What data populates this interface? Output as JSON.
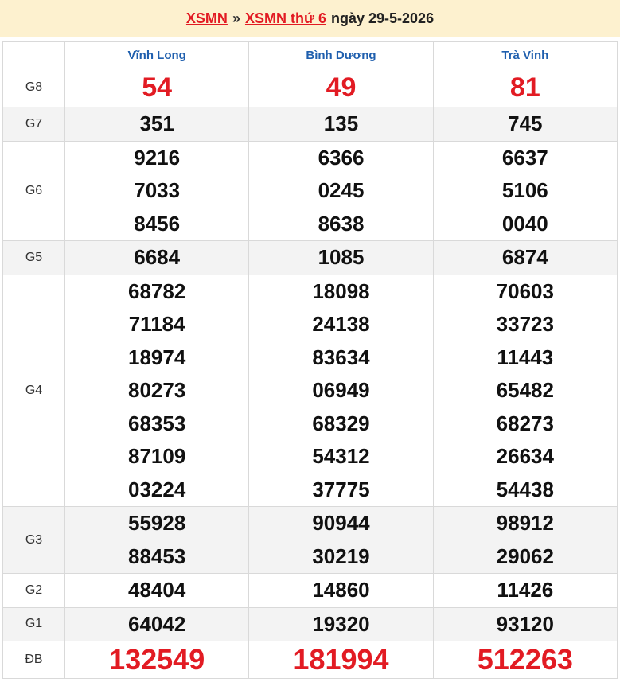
{
  "header": {
    "link1": "XSMN",
    "separator": "»",
    "link2": "XSMN thứ 6",
    "date_text": "ngày 29-5-2026"
  },
  "provinces": [
    "Vĩnh Long",
    "Bình Dương",
    "Trà Vinh"
  ],
  "prizes": [
    {
      "label": "G8",
      "values": [
        [
          "54"
        ],
        [
          "49"
        ],
        [
          "81"
        ]
      ]
    },
    {
      "label": "G7",
      "values": [
        [
          "351"
        ],
        [
          "135"
        ],
        [
          "745"
        ]
      ]
    },
    {
      "label": "G6",
      "values": [
        [
          "9216",
          "7033",
          "8456"
        ],
        [
          "6366",
          "0245",
          "8638"
        ],
        [
          "6637",
          "5106",
          "0040"
        ]
      ]
    },
    {
      "label": "G5",
      "values": [
        [
          "6684"
        ],
        [
          "1085"
        ],
        [
          "6874"
        ]
      ]
    },
    {
      "label": "G4",
      "values": [
        [
          "68782",
          "71184",
          "18974",
          "80273",
          "68353",
          "87109",
          "03224"
        ],
        [
          "18098",
          "24138",
          "83634",
          "06949",
          "68329",
          "54312",
          "37775"
        ],
        [
          "70603",
          "33723",
          "11443",
          "65482",
          "68273",
          "26634",
          "54438"
        ]
      ]
    },
    {
      "label": "G3",
      "values": [
        [
          "55928",
          "88453"
        ],
        [
          "90944",
          "30219"
        ],
        [
          "98912",
          "29062"
        ]
      ]
    },
    {
      "label": "G2",
      "values": [
        [
          "48404"
        ],
        [
          "14860"
        ],
        [
          "11426"
        ]
      ]
    },
    {
      "label": "G1",
      "values": [
        [
          "64042"
        ],
        [
          "19320"
        ],
        [
          "93120"
        ]
      ]
    },
    {
      "label": "ĐB",
      "values": [
        [
          "132549"
        ],
        [
          "181994"
        ],
        [
          "512263"
        ]
      ]
    }
  ],
  "colors": {
    "accent_red": "#e21b23",
    "link_blue": "#1f5fae",
    "header_bg": "#fdf1cf",
    "alt_row_bg": "#f3f3f3"
  }
}
